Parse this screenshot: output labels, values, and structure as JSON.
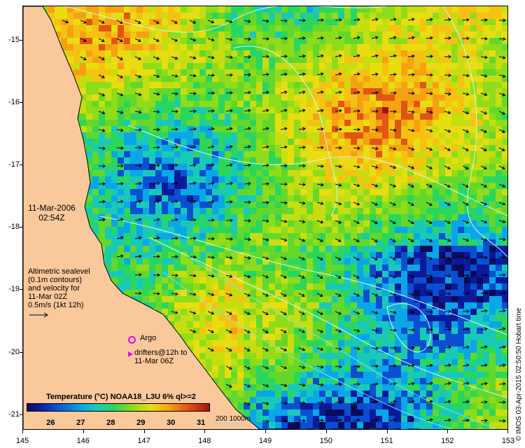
{
  "map": {
    "lat_ticks": [
      "-15",
      "-16",
      "-17",
      "-18",
      "-19",
      "-20",
      "-21"
    ],
    "lat_values": [
      -15,
      -16,
      -17,
      -18,
      -19,
      -20,
      -21
    ],
    "lon_ticks": [
      "145",
      "146",
      "147",
      "148",
      "149",
      "150",
      "151",
      "152",
      "153"
    ],
    "lon_values": [
      145,
      146,
      147,
      148,
      149,
      150,
      151,
      152,
      153
    ],
    "lon_range": [
      145,
      153
    ],
    "lat_range": [
      -14.45,
      -21.25
    ],
    "land_color": "#f9c89b",
    "contour_color": "#d8f4ff",
    "isobath_color": "#7ee6e6",
    "arrow_color": "#000000"
  },
  "annotations": {
    "date": "11-Mar-2006",
    "time": "02:54Z",
    "altimetry_lines": [
      "Altimetric sealevel",
      "(0.1m contours)",
      "and velocity for",
      "11-Mar 02Z",
      "0.5m/s (1kt 12h)"
    ],
    "argo_label": "Argo",
    "drifter_lines": [
      "drifters@12h to",
      "11-Mar 06Z"
    ],
    "argo_color": "#e011e0"
  },
  "legend": {
    "title": "Temperature (°C) NOAA18_L3U 6% ql>=2",
    "ticks": [
      "26",
      "27",
      "28",
      "29",
      "30",
      "31"
    ],
    "tick_values": [
      26,
      27,
      28,
      29,
      30,
      31
    ],
    "range": [
      25.2,
      31.3
    ],
    "depth_label": "200 1000m"
  },
  "credit": "© IMOS 03-Apr-2015 02:50:50 Hobart time"
}
